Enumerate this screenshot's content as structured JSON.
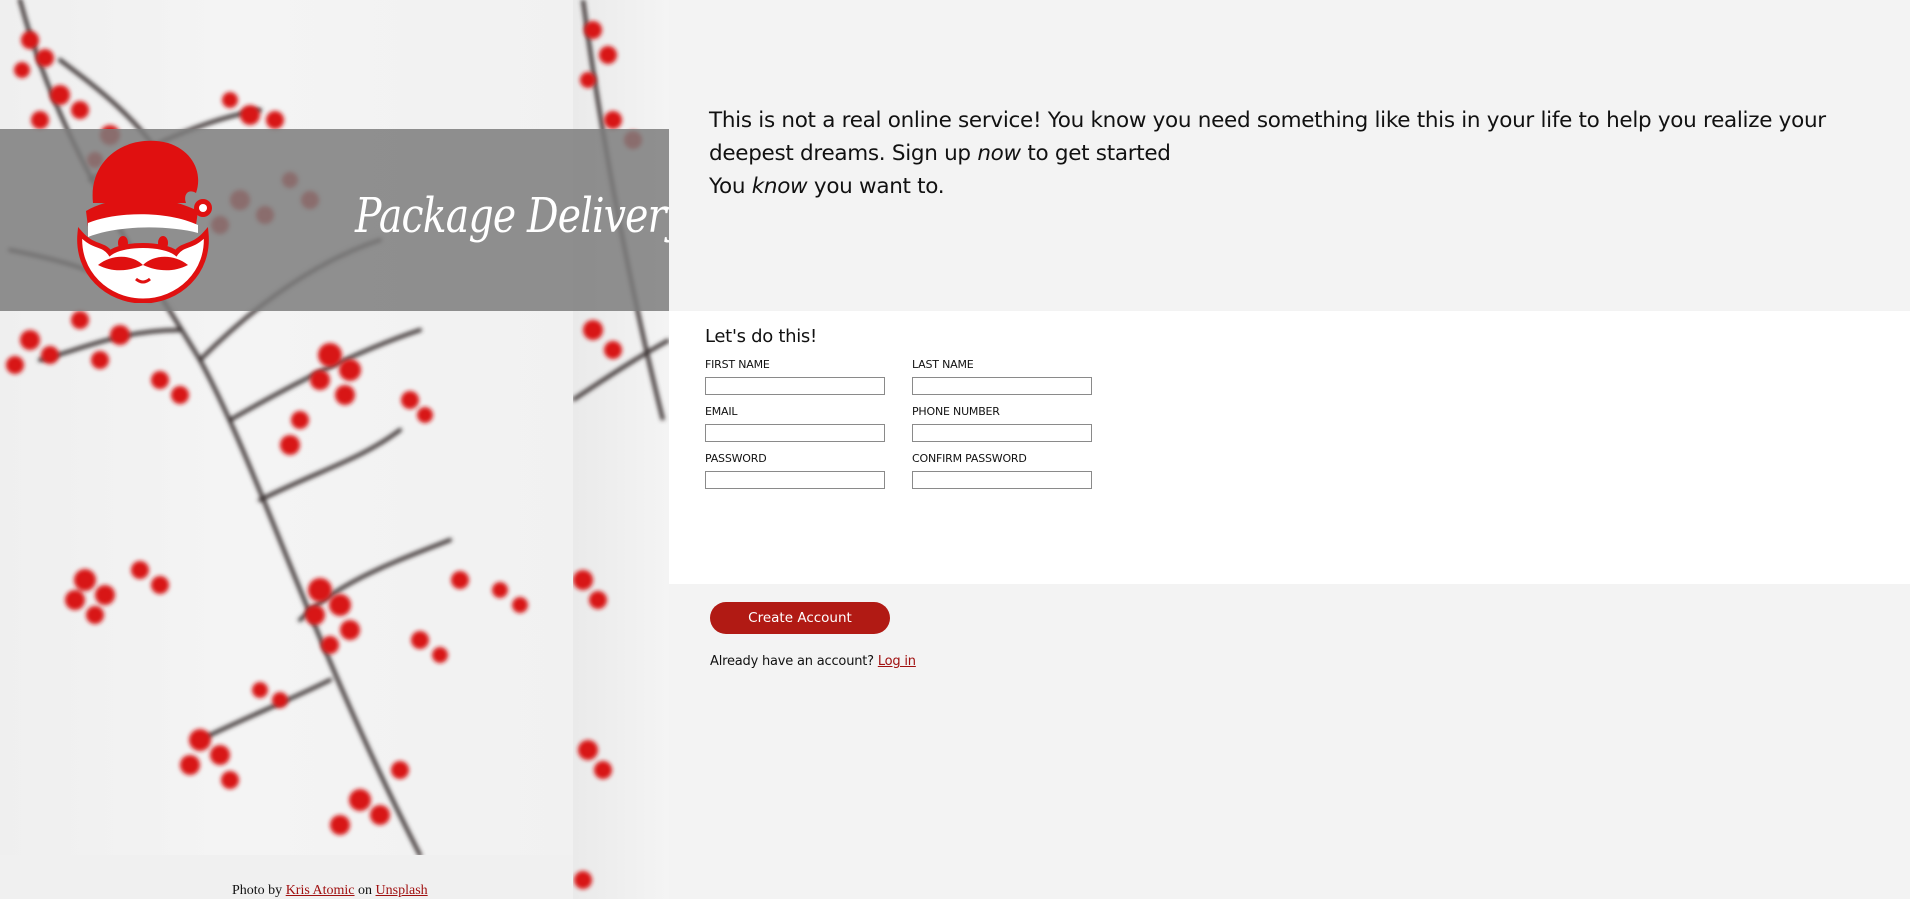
{
  "brand": {
    "title": "Package Delivery",
    "logo_icon": "santa-claus-icon",
    "accent_color": "#e01010"
  },
  "photo_credit": {
    "prefix": "Photo by",
    "author": "Kris Atomic",
    "on": "on",
    "source": "Unsplash"
  },
  "intro": {
    "line1_a": "This is not a real online service! You know you need something like this in your life to help you realize your deepest dreams. Sign up",
    "line1_em": "now",
    "line1_b": "to get started",
    "line2_a": "You",
    "line2_em": "know",
    "line2_b": "you want to."
  },
  "form": {
    "heading": "Let's do this!",
    "fields": {
      "first_name": {
        "label": "FIRST NAME",
        "value": ""
      },
      "last_name": {
        "label": "LAST NAME",
        "value": ""
      },
      "email": {
        "label": "EMAIL",
        "value": ""
      },
      "phone": {
        "label": "PHONE NUMBER",
        "value": ""
      },
      "password": {
        "label": "PASSWORD",
        "value": ""
      },
      "confirm_password": {
        "label": "CONFIRM PASSWORD",
        "value": ""
      }
    },
    "submit_label": "Create Account",
    "login_prompt": "Already have an account?",
    "login_link": "Log in"
  },
  "colors": {
    "button": "#b11a14",
    "link": "#a01010",
    "background": "#f3f3f3",
    "form_band": "#ffffff"
  }
}
